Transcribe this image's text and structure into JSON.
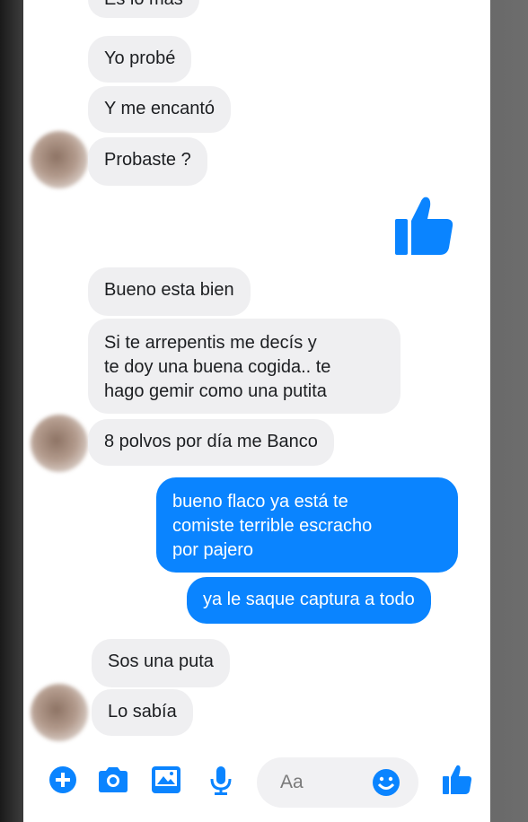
{
  "messages": [
    {
      "text": "Es lo más"
    },
    {
      "text": "Yo probé"
    },
    {
      "text": "Y me encantó"
    },
    {
      "text": "Probaste ?"
    },
    {
      "text": "Bueno esta bien"
    },
    {
      "text": "Si te arrepentis me decís y\nte doy una buena cogida.. te\nhago gemir como una putita"
    },
    {
      "text": "8 polvos por día me Banco"
    },
    {
      "text": "bueno flaco ya está te\ncomiste terrible escracho\npor pajero"
    },
    {
      "text": "ya le saque captura a todo"
    },
    {
      "text": "Sos una puta"
    },
    {
      "text": "Lo sabía"
    }
  ],
  "composer": {
    "placeholder": "Aa",
    "icons": [
      "plus-icon",
      "camera-icon",
      "gallery-icon",
      "microphone-icon",
      "emoji-icon",
      "like-icon"
    ]
  },
  "colors": {
    "accent": "#0a84ff",
    "incoming_bubble": "#efeff1",
    "outgoing_text": "#ffffff"
  }
}
